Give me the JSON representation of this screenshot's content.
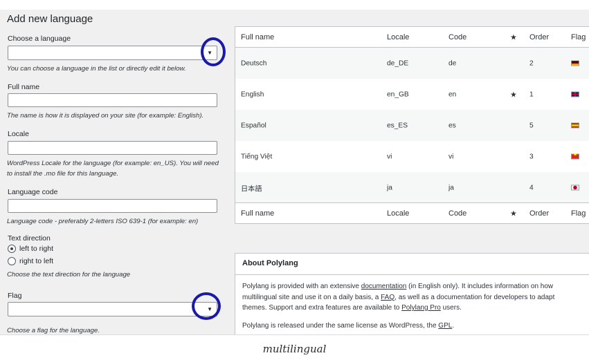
{
  "page_title": "Add new language",
  "form": {
    "choose_language": {
      "label": "Choose a language",
      "value": "",
      "description": "You can choose a language in the list or directly edit it below."
    },
    "full_name": {
      "label": "Full name",
      "value": "",
      "description": "The name is how it is displayed on your site (for example: English)."
    },
    "locale": {
      "label": "Locale",
      "value": "",
      "description_line1": "WordPress Locale for the language (for example: en_US). You will need",
      "description_line2": "to install the .mo file for this language."
    },
    "language_code": {
      "label": "Language code",
      "value": "",
      "description": "Language code - preferably 2-letters ISO 639-1 (for example: en)"
    },
    "text_direction": {
      "label": "Text direction",
      "options": [
        {
          "label": "left to right",
          "checked": true
        },
        {
          "label": "right to left",
          "checked": false
        }
      ],
      "description": "Choose the text direction for the language"
    },
    "flag": {
      "label": "Flag",
      "value": "",
      "description": "Choose a flag for the language."
    }
  },
  "table": {
    "columns": [
      "Full name",
      "Locale",
      "Code",
      "★",
      "Order",
      "Flag"
    ],
    "rows": [
      {
        "name": "Deutsch",
        "locale": "de_DE",
        "code": "de",
        "default": "",
        "order": "2",
        "flag": "flag-de"
      },
      {
        "name": "English",
        "locale": "en_GB",
        "code": "en",
        "default": "★",
        "order": "1",
        "flag": "flag-gb"
      },
      {
        "name": "Español",
        "locale": "es_ES",
        "code": "es",
        "default": "",
        "order": "5",
        "flag": "flag-es"
      },
      {
        "name": "Tiếng Việt",
        "locale": "vi",
        "code": "vi",
        "default": "",
        "order": "3",
        "flag": "flag-vn"
      },
      {
        "name": "日本語",
        "locale": "ja",
        "code": "ja",
        "default": "",
        "order": "4",
        "flag": "flag-jp"
      }
    ]
  },
  "about": {
    "title": "About Polylang",
    "p1_a": "Polylang is provided with an extensive ",
    "p1_link1": "documentation",
    "p1_b": " (in English only). It includes information on how",
    "p1_c": "multilingual site and use it on a daily basis, a ",
    "p1_link2": "FAQ",
    "p1_d": ", as well as a documentation for developers to adapt",
    "p1_e": "themes. Support and extra features are available to ",
    "p1_link3": "Polylang Pro",
    "p1_f": " users.",
    "p2_a": "Polylang is released under the same license as WordPress, the ",
    "p2_link": "GPL",
    "p2_b": "."
  },
  "caption": "multilingual",
  "colors": {
    "annotation_ring": "#1a1aa8",
    "admin_bg": "#f0f0f1"
  }
}
